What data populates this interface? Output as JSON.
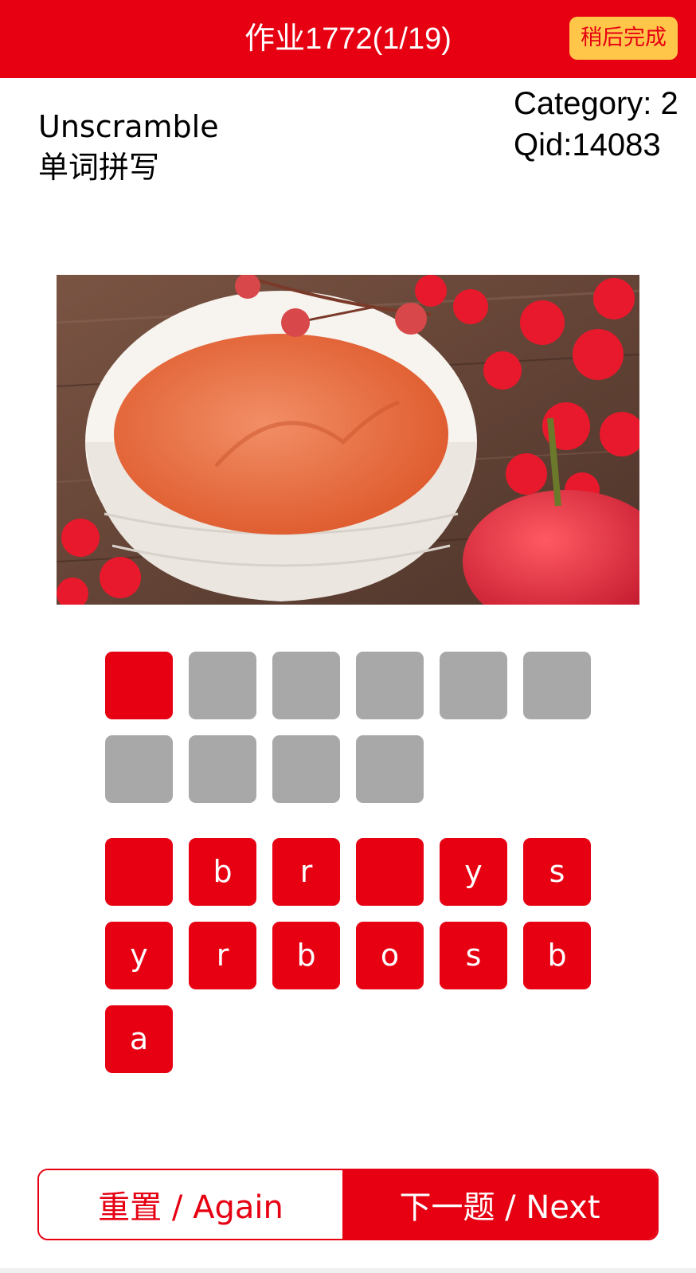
{
  "header": {
    "title": "作业1772(1/19)",
    "later_label": "稍后完成",
    "bg_color": "#e60012",
    "later_bg_color": "#ffc64a"
  },
  "question": {
    "prompt_en": "Unscramble",
    "prompt_zh": "单词拼写",
    "category": "Category: 2",
    "qid": "Qid:14083"
  },
  "image": {
    "icon": "photo-tea-bowl-red-blossoms"
  },
  "answer_slots": [
    {
      "letter": "",
      "state": "active"
    },
    {
      "letter": "",
      "state": "empty"
    },
    {
      "letter": "",
      "state": "empty"
    },
    {
      "letter": "",
      "state": "empty"
    },
    {
      "letter": "",
      "state": "empty"
    },
    {
      "letter": "",
      "state": "empty"
    },
    {
      "letter": "",
      "state": "empty"
    },
    {
      "letter": "",
      "state": "empty"
    },
    {
      "letter": "",
      "state": "empty"
    },
    {
      "letter": "",
      "state": "empty"
    }
  ],
  "letter_bank": [
    {
      "letter": ""
    },
    {
      "letter": "b"
    },
    {
      "letter": "r"
    },
    {
      "letter": ""
    },
    {
      "letter": "y"
    },
    {
      "letter": "s"
    },
    {
      "letter": "y"
    },
    {
      "letter": "r"
    },
    {
      "letter": "b"
    },
    {
      "letter": "o"
    },
    {
      "letter": "s"
    },
    {
      "letter": "b"
    },
    {
      "letter": "a"
    }
  ],
  "actions": {
    "again_label": "重置 / Again",
    "next_label": "下一题 / Next"
  }
}
